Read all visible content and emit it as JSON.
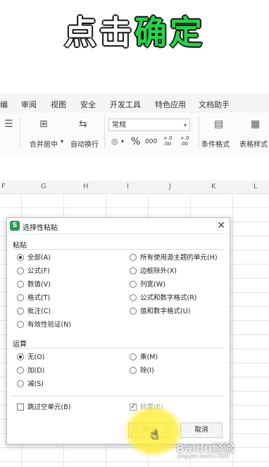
{
  "banner": {
    "part1": "点击",
    "part2": "确定"
  },
  "menubar": {
    "items": [
      "编",
      "审阅",
      "视图",
      "安全",
      "开发工具",
      "特色应用",
      "文档助手"
    ]
  },
  "toolbar": {
    "merge_label": "合并居中",
    "wrap_label": "自动换行",
    "number_format": "常规",
    "cond_format_label": "条件格式",
    "table_style_label": "表格样式",
    "percent": "%",
    "thousands": "000",
    "inc_decimal": "+.0 .00",
    "dec_decimal": "+.0 .00"
  },
  "columns": [
    "F",
    "G",
    "H",
    "I",
    "J",
    "K",
    "L"
  ],
  "dialog": {
    "title": "选择性粘贴",
    "paste_section": "粘贴",
    "paste_left": [
      {
        "label": "全部(A)",
        "checked": true
      },
      {
        "label": "公式(F)",
        "checked": false
      },
      {
        "label": "数值(V)",
        "checked": false
      },
      {
        "label": "格式(T)",
        "checked": false
      },
      {
        "label": "批注(C)",
        "checked": false
      },
      {
        "label": "有效性验证(N)",
        "checked": false
      }
    ],
    "paste_right": [
      {
        "label": "所有使用源主题的单元(H)",
        "checked": false
      },
      {
        "label": "边框除外(X)",
        "checked": false
      },
      {
        "label": "列宽(W)",
        "checked": false
      },
      {
        "label": "公式和数字格式(R)",
        "checked": false
      },
      {
        "label": "值和数字格式(U)",
        "checked": false
      }
    ],
    "operation_section": "运算",
    "op_left": [
      {
        "label": "无(O)",
        "checked": true
      },
      {
        "label": "加(D)",
        "checked": false
      },
      {
        "label": "减(S)",
        "checked": false
      }
    ],
    "op_right": [
      {
        "label": "乘(M)",
        "checked": false
      },
      {
        "label": "除(I)",
        "checked": false
      }
    ],
    "skip_blanks": {
      "label": "跳过空单元(B)",
      "checked": false
    },
    "transpose": {
      "label": "转置(E)",
      "checked": true
    },
    "ok_label": "确定",
    "cancel_label": "取消"
  },
  "watermark": {
    "brand": "Baidu经验",
    "sub": "jingyan.baidu.com"
  }
}
